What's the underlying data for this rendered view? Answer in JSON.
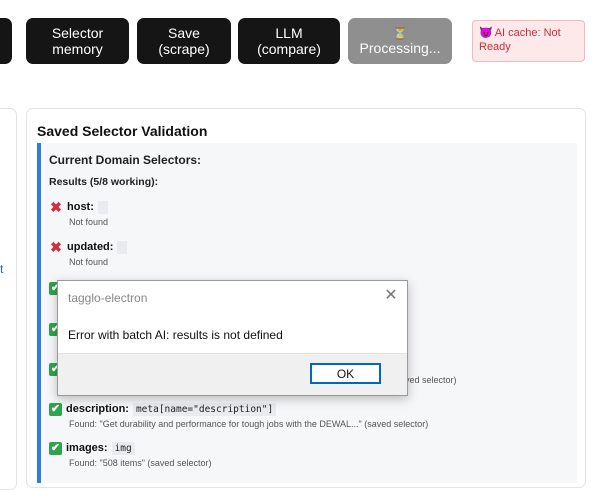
{
  "toolbar": {
    "selector_memory": [
      "Selector",
      "memory"
    ],
    "save": [
      "Save",
      "(scrape)"
    ],
    "llm": [
      "LLM",
      "(compare)"
    ],
    "processing": {
      "icon": "⏳",
      "label": "Processing..."
    }
  },
  "ai_cache": {
    "icon": "😈",
    "text": "AI cache: Not Ready"
  },
  "left_panel": {
    "fragment": "t"
  },
  "validation": {
    "title": "Saved Selector Validation",
    "inner_title": "Current Domain Selectors:",
    "results": "Results (5/8 working):",
    "items": [
      {
        "key": "host:",
        "status": "fail",
        "selector": "",
        "sub": "Not found"
      },
      {
        "key": "updated:",
        "status": "fail",
        "selector": "",
        "sub": "Not found"
      },
      {
        "status": "ok"
      },
      {
        "status": "ok"
      },
      {
        "status": "ok",
        "sub_tail": "ved selector)"
      },
      {
        "key": "description:",
        "status": "ok",
        "selector": "meta[name=\"description\"]",
        "sub": "Found: \"Get durability and performance for tough jobs with the DEWAL...\" (saved selector)"
      },
      {
        "key": "images:",
        "status": "ok",
        "selector": "img",
        "sub": "Found: \"508 items\" (saved selector)"
      }
    ]
  },
  "dialog": {
    "title": "tagglo-electron",
    "message": "Error with batch AI: results is not defined",
    "ok_label": "OK",
    "close_glyph": "✕"
  },
  "icons": {
    "fail": "✖",
    "ok": "✔"
  },
  "colors": {
    "accent": "#2f7fd6",
    "fail": "#d3303f",
    "ok": "#2fa44a"
  }
}
